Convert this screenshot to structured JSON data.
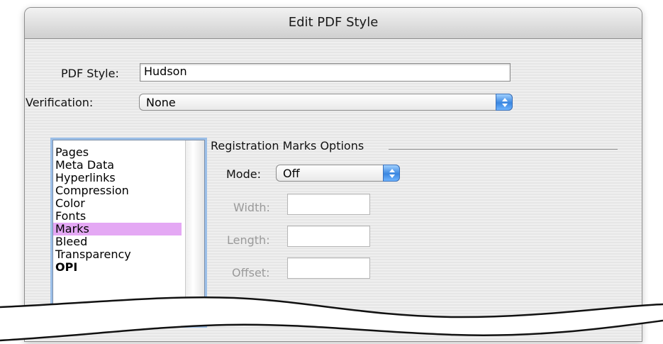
{
  "dialog": {
    "title": "Edit PDF Style"
  },
  "pdf_style": {
    "label": "PDF Style:",
    "value": "Hudson"
  },
  "verification": {
    "label": "Verification:",
    "selected": "None",
    "icon": "popup-arrows-icon"
  },
  "categories": {
    "items": [
      {
        "label": "Pages"
      },
      {
        "label": "Meta Data"
      },
      {
        "label": "Hyperlinks"
      },
      {
        "label": "Compression"
      },
      {
        "label": "Color"
      },
      {
        "label": "Fonts"
      },
      {
        "label": "Marks",
        "selected": true
      },
      {
        "label": "Bleed"
      },
      {
        "label": "Transparency"
      },
      {
        "label": "OPI"
      }
    ],
    "selection_color": "#e4a8f4"
  },
  "registration": {
    "section_title": "Registration Marks Options",
    "mode": {
      "label": "Mode:",
      "selected": "Off"
    },
    "width": {
      "label": "Width:",
      "value": ""
    },
    "length": {
      "label": "Length:",
      "value": ""
    },
    "offset": {
      "label": "Offset:",
      "value": ""
    }
  },
  "colors": {
    "accent_blue": "#3a86e0",
    "dialog_bg": "#ececec"
  }
}
